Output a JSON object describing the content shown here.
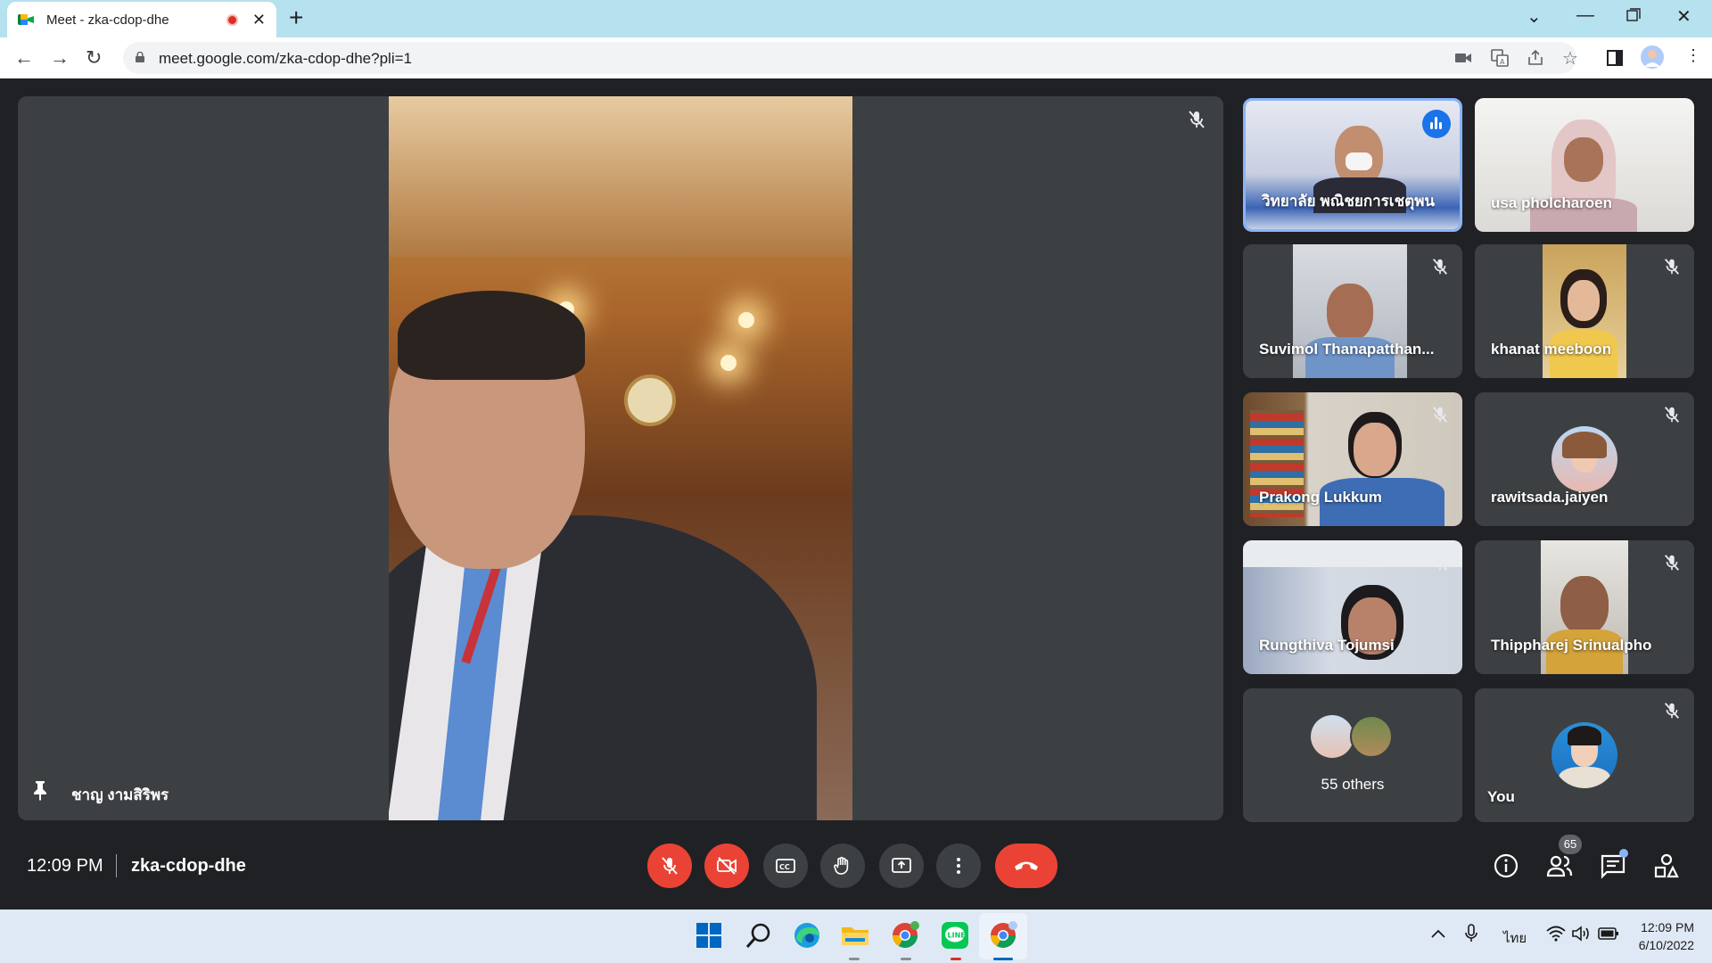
{
  "browser": {
    "tab_title": "Meet - zka-cdop-dhe",
    "url": "meet.google.com/zka-cdop-dhe?pli=1"
  },
  "meeting": {
    "speaker_name": "ชาญ งามสิริพร",
    "time": "12:09 PM",
    "code": "zka-cdop-dhe",
    "participants_count": "65"
  },
  "participants": [
    {
      "name": "วิทยาลัย พณิชยการเชตุพน",
      "muted": false,
      "speaking": true
    },
    {
      "name": "usa pholcharoen",
      "muted": false,
      "speaking": false
    },
    {
      "name": "Suvimol Thanapatthan...",
      "muted": true,
      "speaking": false
    },
    {
      "name": "khanat meeboon",
      "muted": true,
      "speaking": false
    },
    {
      "name": "Prakong Lukkum",
      "muted": true,
      "speaking": false
    },
    {
      "name": "rawitsada.jaiyen",
      "muted": true,
      "speaking": false
    },
    {
      "name": "Rungthiva Tojumsi",
      "muted": true,
      "speaking": false
    },
    {
      "name": "Thippharej Srinualpho",
      "muted": true,
      "speaking": false
    },
    {
      "name": "55 others",
      "muted": false,
      "speaking": false
    },
    {
      "name": "You",
      "muted": true,
      "speaking": false
    }
  ],
  "taskbar": {
    "language": "ไทย",
    "clock_time": "12:09 PM",
    "clock_date": "6/10/2022"
  },
  "colors": {
    "accent_blue": "#1a73e8",
    "hangup_red": "#ea4335",
    "tile_bg": "#3c4043",
    "stage_bg": "#202124"
  }
}
